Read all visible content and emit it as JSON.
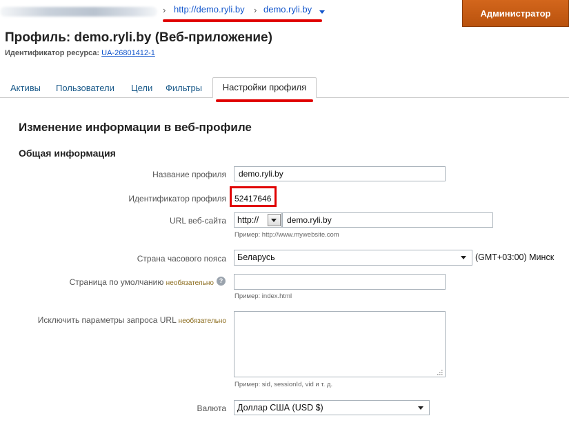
{
  "breadcrumb": {
    "sep": "›",
    "account_link": "http://demo.ryli.by",
    "profile_link": "demo.ryli.by"
  },
  "header": {
    "admin_button": "Администратор",
    "title": "Профиль: demo.ryli.by (Веб-приложение)",
    "resource_label": "Идентификатор ресурса:",
    "resource_id": "UA-26801412-1"
  },
  "tabs": [
    {
      "label": "Активы"
    },
    {
      "label": "Пользователи"
    },
    {
      "label": "Цели"
    },
    {
      "label": "Фильтры"
    },
    {
      "label": "Настройки профиля",
      "active": true
    }
  ],
  "form": {
    "section_title": "Изменение информации в веб-профиле",
    "subsection_title": "Общая информация",
    "profile_name_label": "Название профиля",
    "profile_name_value": "demo.ryli.by",
    "profile_id_label": "Идентификатор профиля",
    "profile_id_value": "52417646",
    "website_url_label": "URL веб-сайта",
    "protocol_value": "http://",
    "website_url_value": "demo.ryli.by",
    "website_url_hint": "Пример: http://www.mywebsite.com",
    "timezone_label": "Страна часового пояса",
    "timezone_country": "Беларусь",
    "timezone_value": "(GMT+03:00) Минск",
    "default_page_label": "Страница по умолчанию",
    "optional_text": "необязательно",
    "help_glyph": "?",
    "default_page_value": "",
    "default_page_hint": "Пример: index.html",
    "exclude_params_label": "Исключить параметры запроса URL",
    "exclude_params_value": "",
    "exclude_params_hint": "Пример: sid, sessionId, vid и т. д.",
    "currency_label": "Валюта",
    "currency_value": "Доллар США (USD $)"
  },
  "colors": {
    "link": "#1155cc",
    "annotation_red": "#e00000",
    "admin_orange": "#c55c15"
  }
}
